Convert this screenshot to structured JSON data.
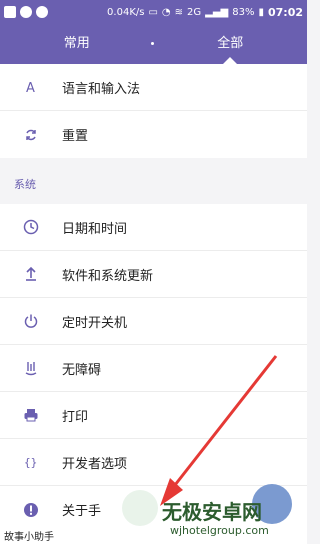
{
  "status_bar": {
    "net_speed": "0.04K/s",
    "network": "2G",
    "battery": "83%",
    "time": "07:02"
  },
  "tabs": [
    {
      "label": "常用"
    },
    {
      "label": "全部"
    }
  ],
  "top_items": [
    {
      "label": "语言和输入法",
      "icon": "language-icon"
    },
    {
      "label": "重置",
      "icon": "reset-icon"
    }
  ],
  "section": {
    "label": "系统"
  },
  "system_items": [
    {
      "label": "日期和时间",
      "icon": "clock-icon"
    },
    {
      "label": "软件和系统更新",
      "icon": "update-icon"
    },
    {
      "label": "定时开关机",
      "icon": "power-icon"
    },
    {
      "label": "无障碍",
      "icon": "accessibility-icon"
    },
    {
      "label": "打印",
      "icon": "printer-icon"
    },
    {
      "label": "开发者选项",
      "icon": "developer-icon"
    },
    {
      "label": "关于手",
      "icon": "info-icon"
    }
  ],
  "watermark": {
    "title": "无极安卓网",
    "url": "wjhotelgroup.com",
    "corner": "故事小助手"
  },
  "colors": {
    "accent": "#6a5fb0",
    "annotation_arrow": "#e53935"
  }
}
